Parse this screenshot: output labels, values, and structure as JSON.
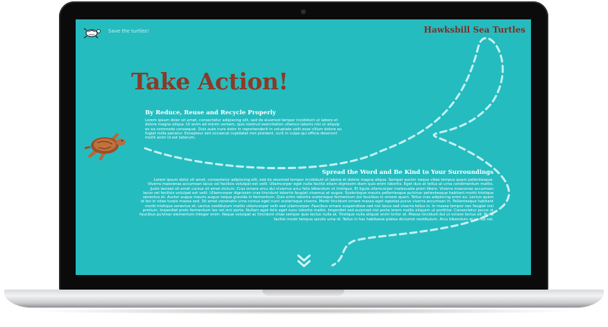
{
  "header": {
    "tagline": "Save the turtles!",
    "site_title": "Hawksbill Sea Turtles",
    "logo_icon": "turtle-logo-icon"
  },
  "hero": {
    "title": "Take Action!"
  },
  "sections": [
    {
      "title": "By Reduce, Reuse and Recycle Properly",
      "body": "Lorem ipsum dolor sit amet, consectetur adipiscing elit, sed do eiusmod tempor incididunt ut labore et dolore magna aliqua. Ut enim ad minim veniam, quis nostrud exercitation ullamco laboris nisi ut aliquip ex ea commodo consequat. Duis aute irure dolor in reprehenderit in voluptate velit esse cillum dolore eu fugiat nulla pariatur. Excepteur sint occaecat cupidatat non proident, sunt in culpa qui officia deserunt mollit anim id est laborum."
    },
    {
      "title": "Spread the Word and Be Kind to Your Surroundings",
      "body": "Lorem ipsum dolor sit amet, consectetur adipiscing elit, sed do eiusmod tempor incididunt ut labore et dolore magna aliqua. Semper auctor neque vitae tempus quam pellentesque. Viverra maecenas accumsan lacus vel facilisis volutpat est velit. Ullamcorper eget nulla facilisi etiam dignissim diam quis enim lobortis. Eget duis at tellus at urna condimentum mattis. Justo laoreet sit amet cursus sit amet dictum. Cras ornare arcu dui vivamus arcu felis bibendum ut tristique. Et ligula ullamcorper malesuada proin libero. Viverra maecenas accumsan lacus vel facilisis volutpat est velit. Ullamcorper dignissim cras tincidunt lobortis feugiat vivamus at augue. Scelerisque mauris pellentesque pulvinar pellentesque habitant morbi tristique senectus et. Auctor augue mauris augue neque gravida in fermentum. Quis enim lobortis scelerisque fermentum dui faucibus in ornare quam. Tellus cras adipiscing enim eu. Lectus quam id leo in vitae turpis massa sed. Sit amet venenatis urna cursus eget nunc scelerisque viverra. Morbi tincidunt ornare massa eget egestas purus viverra accumsan in. Pellentesque habitant morbi tristique senectus et. Lectus vestibulum mattis ullamcorper velit sed ullamcorper. Faucibus ornare suspendisse sed nisi lacus sed viverra tellus in. In massa tempor nec feugiat nisl pretium. Imperdiet proin fermentum leo vel orci porta. Nullam eget felis eget nunc lobortis mattis. Imperdiet sed euismod nisi porta lorem mollis aliquam ut porttitor. Consectetur purus ut faucibus pulvinar elementum integer enim. Neque volutpat ac tincidunt vitae semper quis lectus nulla at. Tristique nulla aliquet enim tortor at. Massa tincidunt dui ut ornare lectus sit. Nulla facilisi morbi tempus iaculis urna id. Tellus in hac habitasse platea dictumst vestibulum. Arcu bibendum at varius vel."
    }
  ],
  "scroll_icon": "double-chevron-down-icon",
  "colors": {
    "background": "#25bcc0",
    "title": "#8b3a27",
    "site_title": "#7c2f24",
    "path": "#c8f1f2"
  }
}
